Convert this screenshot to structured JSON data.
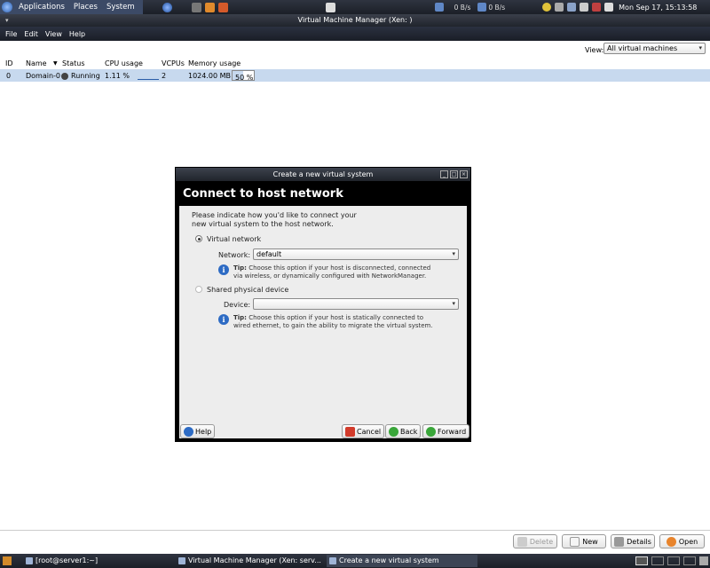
{
  "top_panel": {
    "menus": [
      "Applications",
      "Places",
      "System"
    ],
    "net_down": "0 B/s",
    "net_up": "0 B/s",
    "clock": "Mon Sep 17, 15:13:58"
  },
  "window": {
    "title": "Virtual Machine Manager (Xen:                          )",
    "menu": [
      "File",
      "Edit",
      "View",
      "Help"
    ],
    "view_label": "View:",
    "view_select": "All virtual machines"
  },
  "table": {
    "columns": [
      "ID",
      "Name",
      "Status",
      "CPU usage",
      "VCPUs",
      "Memory usage"
    ],
    "rows": [
      {
        "id": "0",
        "name": "Domain-0",
        "status": "Running",
        "cpu": "1.11 %",
        "vcpus": "2",
        "memory": "1024.00 MB",
        "mem_pct": "50 %",
        "mem_fraction": 0.5
      }
    ]
  },
  "buttons": {
    "delete": "Delete",
    "new": "New",
    "details": "Details",
    "open": "Open"
  },
  "taskbar": {
    "tasks": [
      "[root@server1:~]",
      "Virtual Machine Manager (Xen: serv...",
      "Create a new virtual system"
    ]
  },
  "dialog": {
    "title": "Create a new virtual system",
    "heading": "Connect to host network",
    "intro_line1": "Please indicate how you'd like to connect your",
    "intro_line2": "new virtual system to the host network.",
    "virtual_network_label": "Virtual network",
    "network_label": "Network:",
    "network_value": "default",
    "tip1_label": "Tip:",
    "tip1_line1": "Choose this option if your host is disconnected, connected",
    "tip1_line2": "via wireless, or dynamically configured with NetworkManager.",
    "shared_device_label": "Shared physical device",
    "device_label": "Device:",
    "device_value": "",
    "tip2_label": "Tip:",
    "tip2_line1": "Choose this option if your host is statically connected to",
    "tip2_line2": "wired ethernet, to gain the ability to migrate the virtual system.",
    "help": "Help",
    "cancel": "Cancel",
    "back": "Back",
    "forward": "Forward"
  },
  "colors": {
    "panel": "#1b1f27",
    "selection": "#c7d9ee",
    "info": "#2d6bc4"
  }
}
